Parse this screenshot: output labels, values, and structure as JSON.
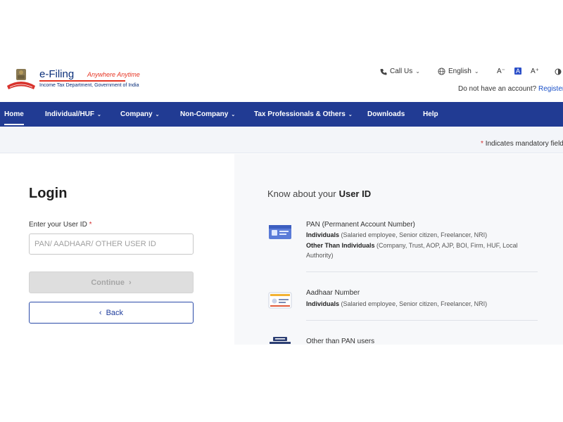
{
  "brand": {
    "name": "e-Filing",
    "tagline": "Anywhere Anytime",
    "subtitle": "Income Tax Department, Government of India"
  },
  "header": {
    "call_us": "Call Us",
    "language": "English",
    "font_small": "A⁻",
    "font_normal": "A",
    "font_large": "A⁺",
    "no_account": "Do not have an account?",
    "register": "Register"
  },
  "nav": {
    "items": [
      {
        "label": "Home"
      },
      {
        "label": "Individual/HUF"
      },
      {
        "label": "Company"
      },
      {
        "label": "Non-Company"
      },
      {
        "label": "Tax Professionals & Others"
      },
      {
        "label": "Downloads"
      },
      {
        "label": "Help"
      }
    ],
    "active": "Home",
    "color": "#213b93"
  },
  "mandatory": {
    "star": "*",
    "text": "Indicates mandatory field"
  },
  "login": {
    "title": "Login",
    "user_id_label": "Enter your User ID",
    "required_star": "*",
    "user_id_placeholder": "PAN/ AADHAAR/ OTHER USER ID",
    "user_id_value": "",
    "continue_label": "Continue",
    "back_label": "Back"
  },
  "know": {
    "title": "Know about your",
    "title_strong": "User ID",
    "items": [
      {
        "icon": "pan-card-icon",
        "title": "PAN (Permanent Account Number)",
        "line1_bold": "Individuals",
        "line1_text": "(Salaried employee, Senior citizen, Freelancer, NRI)",
        "line2_bold": "Other Than Individuals",
        "line2_text": "(Company, Trust, AOP, AJP, BOI, Firm, HUF, Local",
        "line3_text": "Authority)"
      },
      {
        "icon": "aadhaar-card-icon",
        "title": "Aadhaar Number",
        "line1_bold": "Individuals",
        "line1_text": "(Salaried employee, Senior citizen, Freelancer, NRI)"
      },
      {
        "icon": "other-users-icon",
        "title": "Other than PAN users"
      }
    ]
  },
  "colors": {
    "primary": "#213b93",
    "link": "#1a50c8",
    "required": "#d32f2f",
    "brand_red": "#e63422"
  }
}
